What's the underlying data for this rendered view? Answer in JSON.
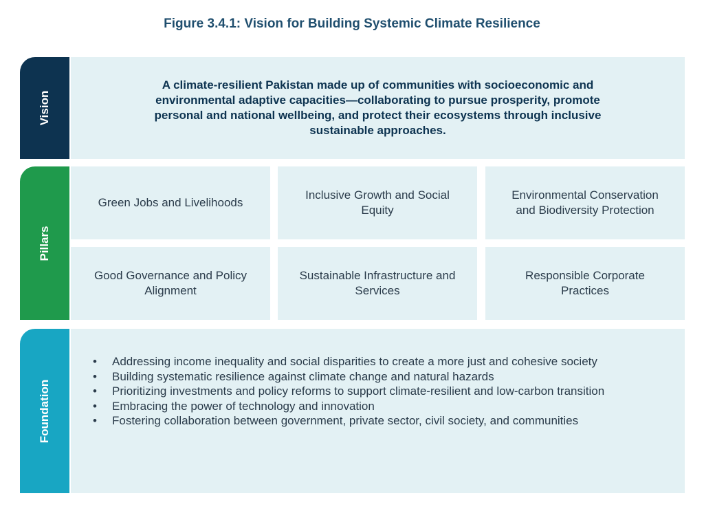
{
  "title": "Figure 3.4.1: Vision for Building Systemic Climate Resilience",
  "rows": {
    "vision": "Vision",
    "pillars": "Pillars",
    "foundation": "Foundation"
  },
  "vision_text": "A climate-resilient Pakistan made up of communities with socioeconomic and environmental adaptive capacities—collaborating to pursue prosperity, promote personal and national wellbeing, and protect their ecosystems through inclusive sustainable approaches.",
  "pillars": [
    "Green Jobs and Livelihoods",
    "Inclusive Growth and Social Equity",
    "Environmental Conservation and Biodiversity Protection",
    "Good Governance and Policy Alignment",
    "Sustainable Infrastructure and Services",
    "Responsible Corporate Practices"
  ],
  "foundation": [
    "Addressing income inequality and social disparities to create a more just and cohesive society",
    "Building systematic resilience against climate change and natural hazards",
    "Prioritizing investments and policy reforms to support climate-resilient and low-carbon transition",
    "Embracing the power of technology and innovation",
    "Fostering collaboration between government, private sector, civil society, and communities"
  ],
  "colors": {
    "vision_tab": "#0d3350",
    "pillars_tab": "#1f9a4c",
    "foundation_tab": "#18a6c3",
    "panel": "#e3f1f4",
    "title": "#1f4e6e"
  }
}
